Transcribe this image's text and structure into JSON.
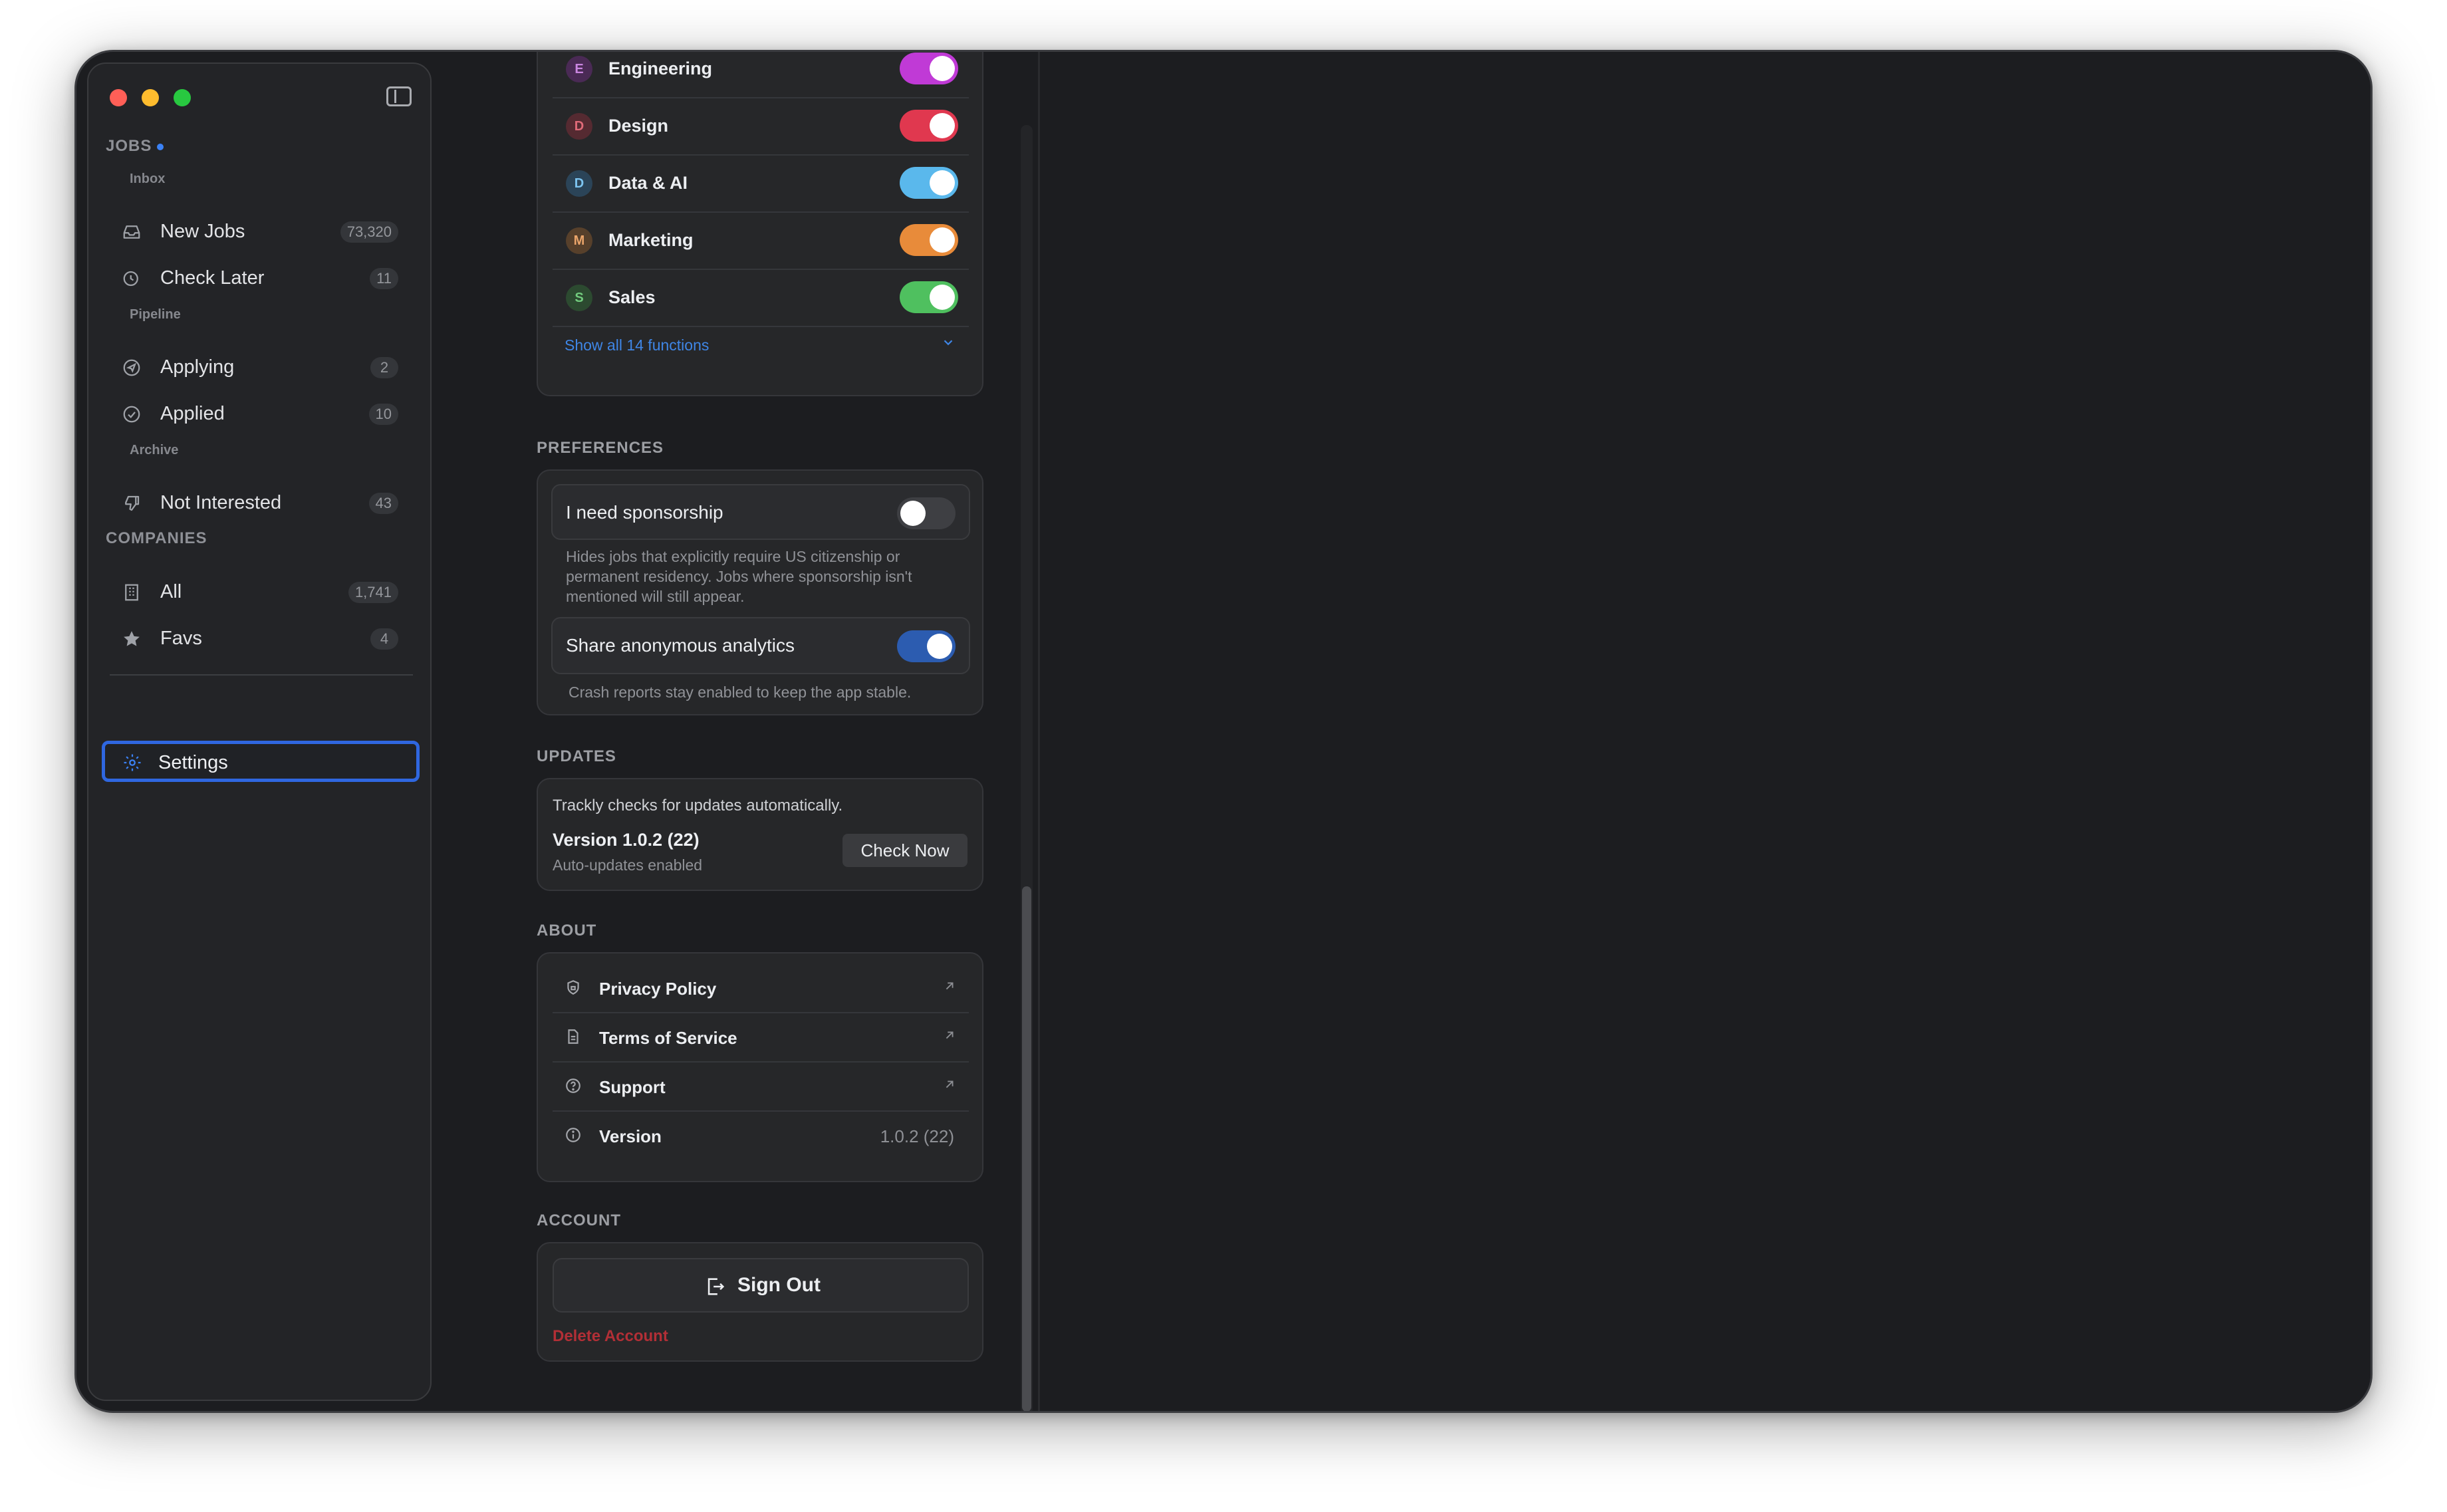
{
  "sidebar": {
    "jobs_header": "JOBS",
    "inbox_label": "Inbox",
    "pipeline_label": "Pipeline",
    "archive_label": "Archive",
    "companies_header": "COMPANIES",
    "items": {
      "new_jobs": {
        "label": "New Jobs",
        "count": "73,320"
      },
      "check_later": {
        "label": "Check Later",
        "count": "11"
      },
      "applying": {
        "label": "Applying",
        "count": "2"
      },
      "applied": {
        "label": "Applied",
        "count": "10"
      },
      "not_interested": {
        "label": "Not Interested",
        "count": "43"
      },
      "all": {
        "label": "All",
        "count": "1,741"
      },
      "favs": {
        "label": "Favs",
        "count": "4"
      }
    },
    "settings_label": "Settings"
  },
  "functions": {
    "items": [
      {
        "initial": "E",
        "label": "Engineering",
        "enabled": true,
        "color": "#c03ad6"
      },
      {
        "initial": "D",
        "label": "Design",
        "enabled": true,
        "color": "#e0384f"
      },
      {
        "initial": "D",
        "label": "Data & AI",
        "enabled": true,
        "color": "#5ab8ec"
      },
      {
        "initial": "M",
        "label": "Marketing",
        "enabled": true,
        "color": "#e88b3a"
      },
      {
        "initial": "S",
        "label": "Sales",
        "enabled": true,
        "color": "#4fc05f"
      }
    ],
    "show_all": "Show all 14 functions"
  },
  "preferences": {
    "header": "PREFERENCES",
    "sponsorship": {
      "label": "I need sponsorship",
      "enabled": false,
      "desc": "Hides jobs that explicitly require US citizenship or permanent residency. Jobs where sponsorship isn't mentioned will still appear."
    },
    "analytics": {
      "label": "Share anonymous analytics",
      "enabled": true,
      "desc": "Crash reports stay enabled to keep the app stable."
    }
  },
  "updates": {
    "header": "UPDATES",
    "text": "Trackly checks for updates automatically.",
    "version": "Version 1.0.2 (22)",
    "auto": "Auto-updates enabled",
    "check_now": "Check Now"
  },
  "about": {
    "header": "ABOUT",
    "privacy": "Privacy Policy",
    "terms": "Terms of Service",
    "support": "Support",
    "version_label": "Version",
    "version_value": "1.0.2 (22)"
  },
  "account": {
    "header": "ACCOUNT",
    "sign_out": "Sign Out",
    "delete": "Delete Account"
  }
}
